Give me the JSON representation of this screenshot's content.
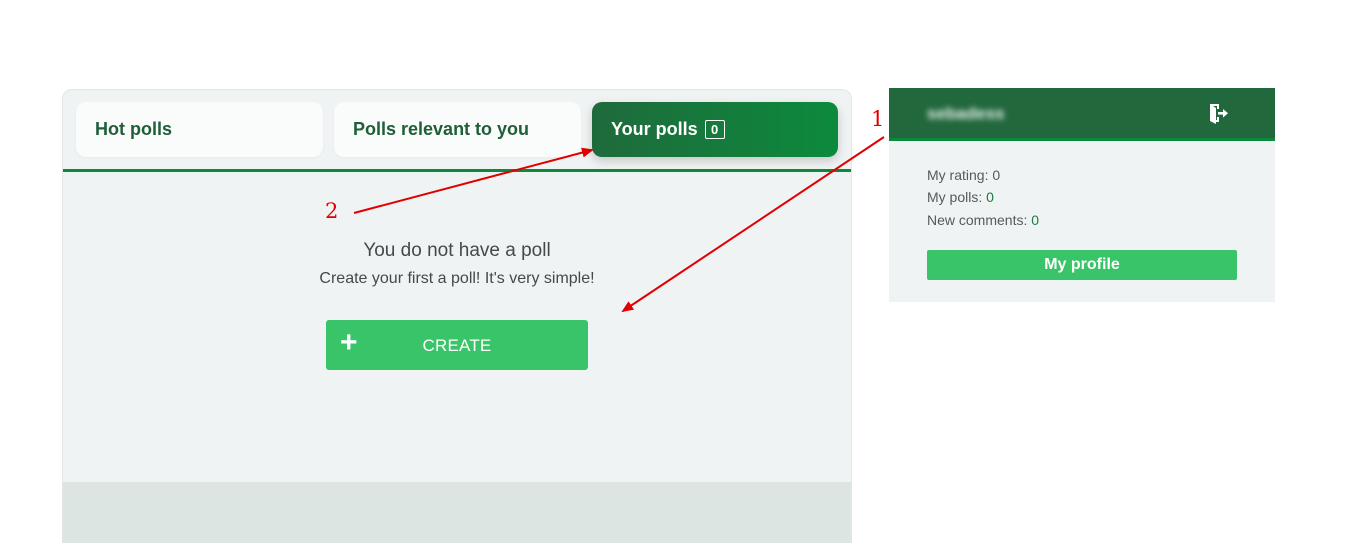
{
  "tabs": {
    "hot": "Hot polls",
    "relevant": "Polls relevant to you",
    "yours": "Your polls",
    "yours_count": "0"
  },
  "empty_state": {
    "title": "You do not have a poll",
    "subtitle": "Create your first a poll! It's very simple!",
    "create_icon": "+",
    "create_label": "CREATE"
  },
  "user": {
    "name": "sebadess",
    "logout_icon": "logout-door-icon",
    "rating_label": "My rating: ",
    "rating_value": "0",
    "polls_label": "My polls: ",
    "polls_value": "0",
    "comments_label": "New comments: ",
    "comments_value": "0",
    "profile_button": "My profile"
  },
  "annotations": {
    "marker_1": "1",
    "marker_2": "2",
    "color": "#e00000"
  },
  "colors": {
    "accent_green": "#0c8a3c",
    "button_green": "#3ac46a",
    "header_green": "#22683d"
  }
}
